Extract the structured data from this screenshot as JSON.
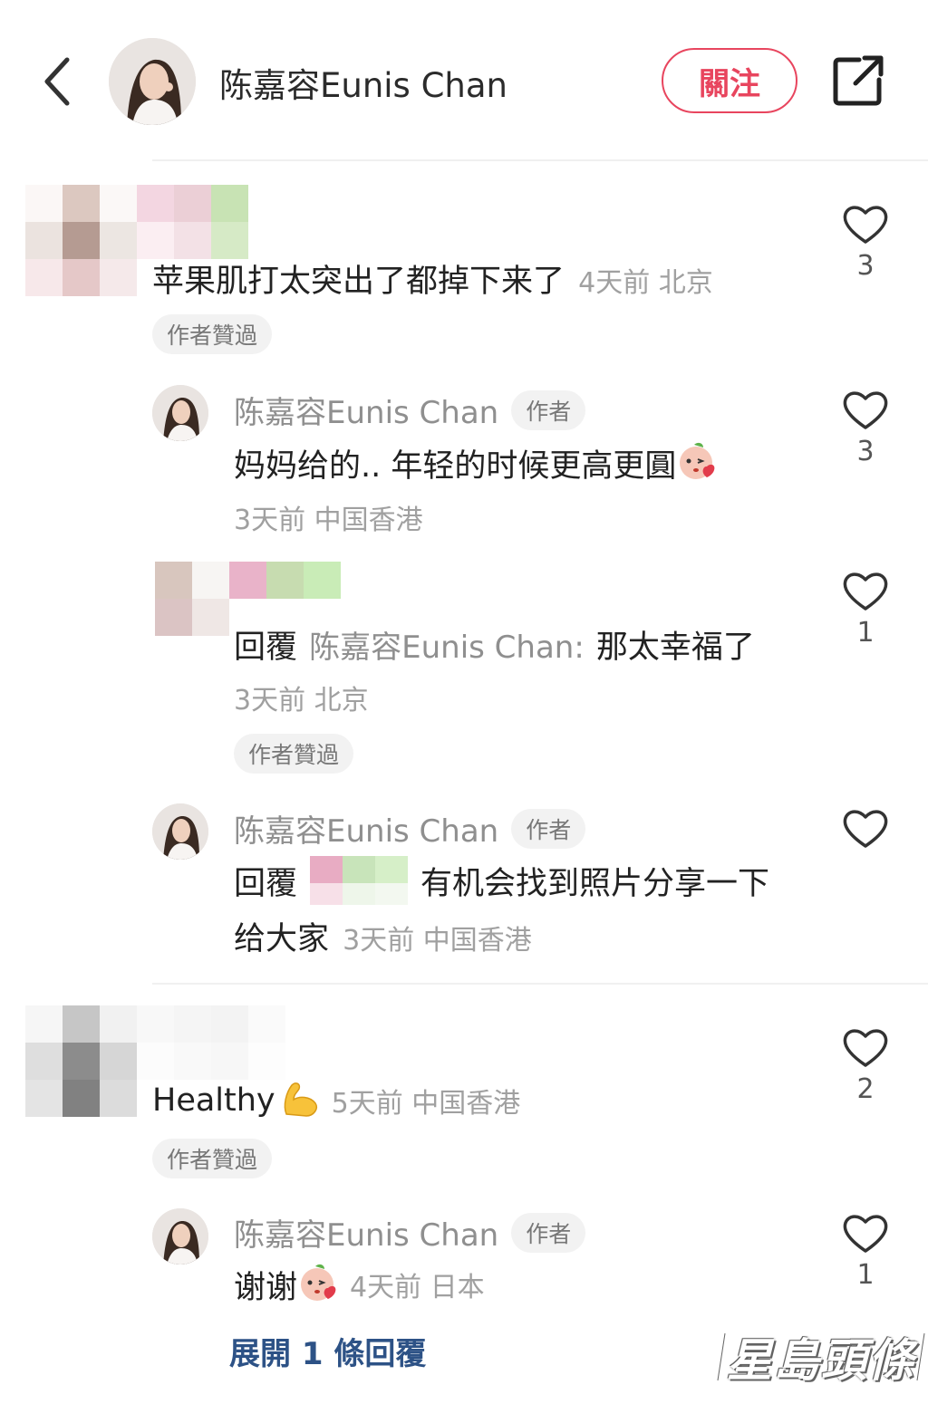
{
  "header": {
    "title": "陈嘉容Eunis Chan",
    "follow_label": "關注"
  },
  "comments": [
    {
      "text": "苹果肌打太突出了都掉下来了",
      "meta": "4天前 北京",
      "likes": "3",
      "badge": "作者贊過"
    },
    {
      "author": "陈嘉容Eunis Chan",
      "author_tag": "作者",
      "text": "妈妈给的.. 年轻的时候更高更圓",
      "meta": "3天前 中国香港",
      "likes": "3"
    },
    {
      "reply_prefix": "回覆",
      "reply_to": "陈嘉容Eunis Chan:",
      "text": "那太幸福了",
      "meta": "3天前 北京",
      "likes": "1",
      "badge": "作者贊過"
    },
    {
      "author": "陈嘉容Eunis Chan",
      "author_tag": "作者",
      "reply_prefix": "回覆",
      "text_line1": "有机会找到照片分享一下",
      "text_line2": "给大家",
      "meta": "3天前 中国香港"
    },
    {
      "text": "Healthy",
      "meta": "5天前 中国香港",
      "likes": "2",
      "badge": "作者贊過"
    },
    {
      "author": "陈嘉容Eunis Chan",
      "author_tag": "作者",
      "text": "谢谢",
      "meta": "4天前 日本",
      "likes": "1"
    }
  ],
  "expand_label": "展開 1 條回覆",
  "watermark": "星島頭條",
  "colors": {
    "accent": "#e8455e",
    "link": "#2d5286",
    "meta": "#a0a0a0"
  }
}
